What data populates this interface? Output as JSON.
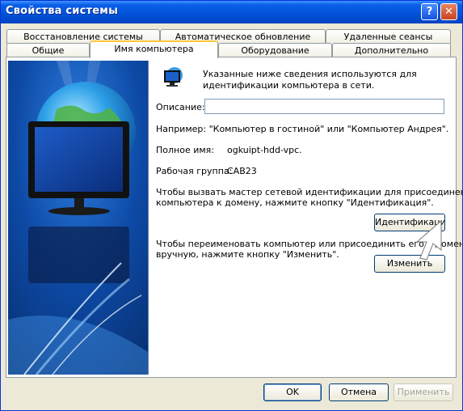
{
  "window": {
    "title": "Свойства системы",
    "help_label": "?",
    "close_label": "✕"
  },
  "tabs_top": [
    "Восстановление системы",
    "Автоматическое обновление",
    "Удаленные сеансы"
  ],
  "tabs_bottom": [
    "Общие",
    "Имя компьютера",
    "Оборудование",
    "Дополнительно"
  ],
  "active_tab": "Имя компьютера",
  "content": {
    "intro_line1": "Указанные ниже сведения используются для",
    "intro_line2": "идентификации компьютера в сети.",
    "description_label": "Описание:",
    "description_value": "",
    "example_text": "Например: \"Компьютер в гостиной\" или \"Компьютер Андрея\".",
    "fullname_label": "Полное имя:",
    "fullname_value": "ogkuipt-hdd-vpc.",
    "workgroup_label": "Рабочая группа:",
    "workgroup_value": "CAB23",
    "wizard_line1": "Чтобы вызвать мастер сетевой идентификации для присоединения",
    "wizard_line2": "компьютера к домену, нажмите кнопку \"Идентификация\".",
    "identification_button": "Идентификация",
    "rename_line1": "Чтобы переименовать компьютер или присоединить его к домену",
    "rename_line2": "вручную, нажмите кнопку \"Изменить\".",
    "change_button": "Изменить"
  },
  "footer": {
    "ok": "OK",
    "cancel": "Отмена",
    "apply": "Применить"
  },
  "colors": {
    "titlebar": "#0252d8",
    "dialog_bg": "#ece9d8",
    "tab_highlight": "#ffc83c"
  }
}
